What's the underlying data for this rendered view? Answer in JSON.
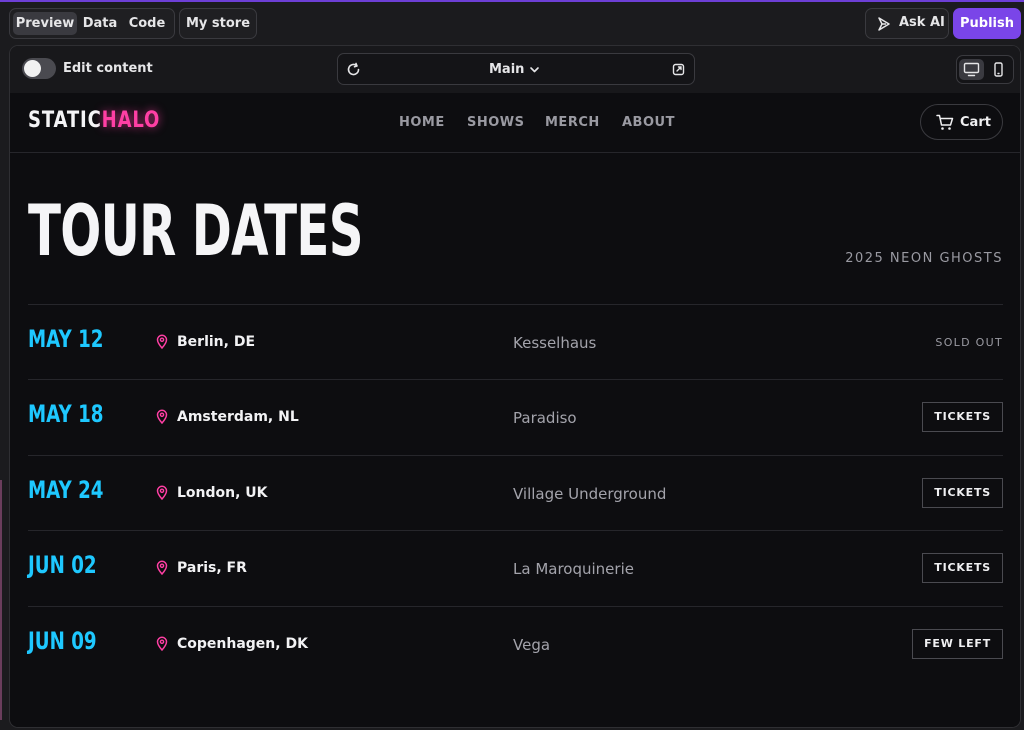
{
  "builder": {
    "tabs": [
      {
        "label": "Preview",
        "active": true
      },
      {
        "label": "Data",
        "active": false
      },
      {
        "label": "Code",
        "active": false
      }
    ],
    "store_label": "My store",
    "ask_ai_label": "Ask AI",
    "publish_label": "Publish",
    "edit_content_label": "Edit content",
    "edit_content_on": false,
    "page_selector": "Main",
    "accent_color": "#7a45e8"
  },
  "site": {
    "logo": {
      "part1": "STATIC",
      "part2": "HALO"
    },
    "nav": [
      "HOME",
      "SHOWS",
      "MERCH",
      "ABOUT"
    ],
    "cart_label": "Cart",
    "title": "TOUR DATES",
    "subtitle": "2025 NEON GHOSTS",
    "colors": {
      "date": "#1ec8ff",
      "pin": "#ff3fa4",
      "logo_accent": "#ff3fa4"
    },
    "shows": [
      {
        "date": "MAY 12",
        "city": "Berlin, DE",
        "venue": "Kesselhaus",
        "status": "SOLD OUT",
        "is_button": false
      },
      {
        "date": "MAY 18",
        "city": "Amsterdam, NL",
        "venue": "Paradiso",
        "status": "TICKETS",
        "is_button": true
      },
      {
        "date": "MAY 24",
        "city": "London, UK",
        "venue": "Village Underground",
        "status": "TICKETS",
        "is_button": true
      },
      {
        "date": "JUN 02",
        "city": "Paris, FR",
        "venue": "La Maroquinerie",
        "status": "TICKETS",
        "is_button": true
      },
      {
        "date": "JUN 09",
        "city": "Copenhagen, DK",
        "venue": "Vega",
        "status": "FEW LEFT",
        "is_button": true
      }
    ]
  }
}
